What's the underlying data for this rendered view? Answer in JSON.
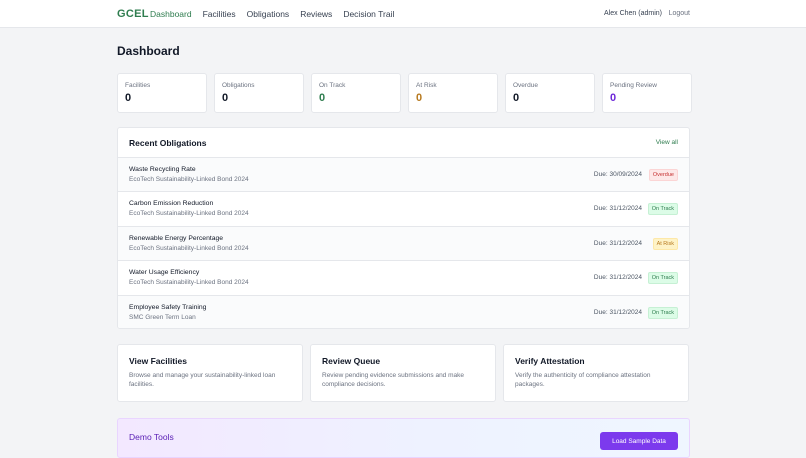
{
  "brand": "GCEL",
  "nav": [
    {
      "label": "Dashboard",
      "active": true
    },
    {
      "label": "Facilities",
      "active": false
    },
    {
      "label": "Obligations",
      "active": false
    },
    {
      "label": "Reviews",
      "active": false
    },
    {
      "label": "Decision Trail",
      "active": false
    }
  ],
  "user": {
    "name": "Alex Chen (admin)",
    "logout": "Logout"
  },
  "page_title": "Dashboard",
  "stats": [
    {
      "label": "Facilities",
      "value": "0",
      "color": "#111827"
    },
    {
      "label": "Obligations",
      "value": "0",
      "color": "#111827"
    },
    {
      "label": "On Track",
      "value": "0",
      "color": "#2f7d4f"
    },
    {
      "label": "At Risk",
      "value": "0",
      "color": "#b7791f"
    },
    {
      "label": "Overdue",
      "value": "0",
      "color": "#111827"
    },
    {
      "label": "Pending Review",
      "value": "0",
      "color": "#6d28d9"
    }
  ],
  "recent": {
    "title": "Recent Obligations",
    "view_all": "View all",
    "rows": [
      {
        "name": "Waste Recycling Rate",
        "facility": "EcoTech Sustainability-Linked Bond 2024",
        "due": "Due: 30/09/2024",
        "status": "Overdue",
        "status_bg": "#fde8e8",
        "status_fg": "#c53030",
        "status_border": "#fbd5d5"
      },
      {
        "name": "Carbon Emission Reduction",
        "facility": "EcoTech Sustainability-Linked Bond 2024",
        "due": "Due: 31/12/2024",
        "status": "On Track",
        "status_bg": "#dcfce7",
        "status_fg": "#2f7d4f",
        "status_border": "#c6f0d4"
      },
      {
        "name": "Renewable Energy Percentage",
        "facility": "EcoTech Sustainability-Linked Bond 2024",
        "due": "Due: 31/12/2024",
        "status": "At Risk",
        "status_bg": "#fef3c7",
        "status_fg": "#b7791f",
        "status_border": "#fde8a8"
      },
      {
        "name": "Water Usage Efficiency",
        "facility": "EcoTech Sustainability-Linked Bond 2024",
        "due": "Due: 31/12/2024",
        "status": "On Track",
        "status_bg": "#dcfce7",
        "status_fg": "#2f7d4f",
        "status_border": "#c6f0d4"
      },
      {
        "name": "Employee Safety Training",
        "facility": "SMC Green Term Loan",
        "due": "Due: 31/12/2024",
        "status": "On Track",
        "status_bg": "#dcfce7",
        "status_fg": "#2f7d4f",
        "status_border": "#c6f0d4"
      }
    ]
  },
  "cards": [
    {
      "title": "View Facilities",
      "desc": "Browse and manage your sustainability-linked loan facilities."
    },
    {
      "title": "Review Queue",
      "desc": "Review pending evidence submissions and make compliance decisions."
    },
    {
      "title": "Verify Attestation",
      "desc": "Verify the authenticity of compliance attestation packages."
    }
  ],
  "demo": {
    "title": "Demo Tools",
    "button": "Load Sample Data"
  }
}
